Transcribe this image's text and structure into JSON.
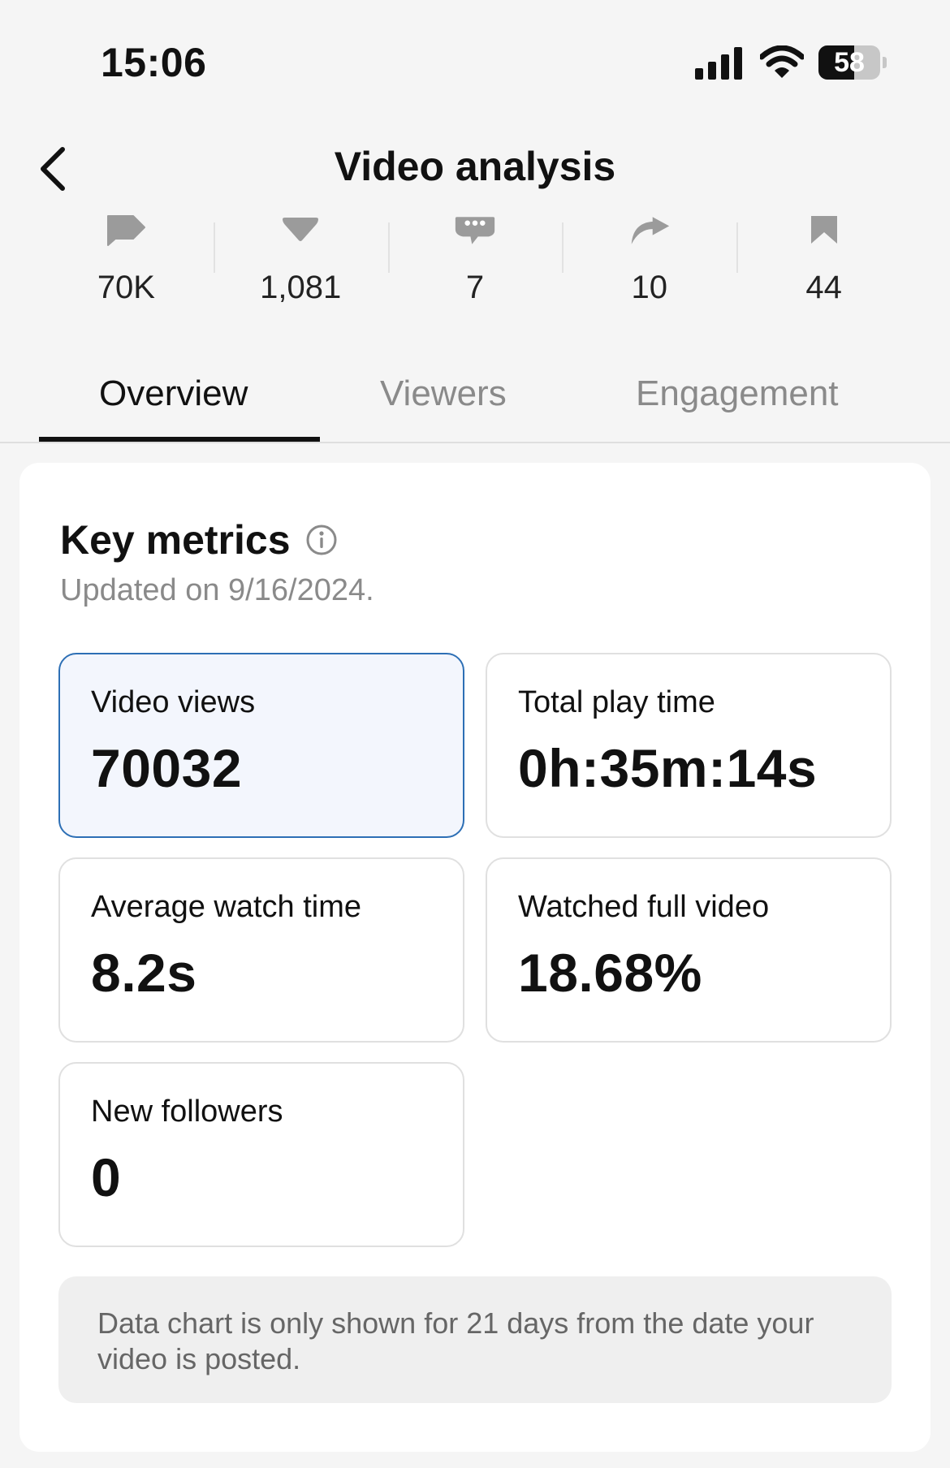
{
  "status_bar": {
    "time": "15:06",
    "battery_level": "58",
    "battery_fraction": 0.58,
    "icons": [
      "cellular-signal-icon",
      "wifi-icon",
      "battery-icon"
    ]
  },
  "header": {
    "title": "Video analysis",
    "back_icon": "chevron-left-icon"
  },
  "stats": [
    {
      "icon": "play-flag-icon",
      "value": "70K"
    },
    {
      "icon": "heart-icon",
      "value": "1,081"
    },
    {
      "icon": "comment-icon",
      "value": "7"
    },
    {
      "icon": "share-arrow-icon",
      "value": "10"
    },
    {
      "icon": "bookmark-icon",
      "value": "44"
    }
  ],
  "tabs": [
    {
      "label": "Overview",
      "active": true
    },
    {
      "label": "Viewers",
      "active": false
    },
    {
      "label": "Engagement",
      "active": false
    }
  ],
  "key_metrics": {
    "title": "Key metrics",
    "info_icon": "info-icon",
    "updated": "Updated on 9/16/2024.",
    "metrics": [
      {
        "label": "Video views",
        "value": "70032",
        "selected": true
      },
      {
        "label": "Total play time",
        "value": "0h:35m:14s",
        "selected": false
      },
      {
        "label": "Average watch time",
        "value": "8.2s",
        "selected": false
      },
      {
        "label": "Watched full video",
        "value": "18.68%",
        "selected": false
      },
      {
        "label": "New followers",
        "value": "0",
        "selected": false
      }
    ],
    "notice": "Data chart is only shown for 21 days from the date your video is posted."
  },
  "colors": {
    "background": "#f5f5f5",
    "selected_border": "#2d6fb5",
    "selected_fill": "#f3f6fd",
    "muted_text": "#8a8a8a"
  }
}
